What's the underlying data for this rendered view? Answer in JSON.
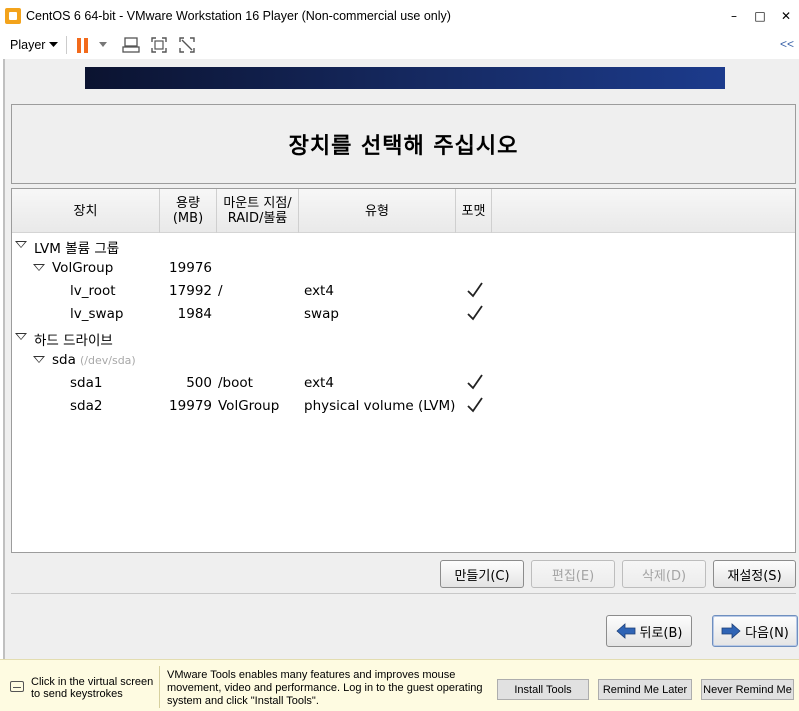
{
  "window": {
    "title": "CentOS 6 64-bit - VMware Workstation 16 Player (Non-commercial use only)",
    "minimize": "–",
    "maximize": "□",
    "close": "✕"
  },
  "toolbar": {
    "player_menu": "Player",
    "collapse": "<<"
  },
  "installer": {
    "heading": "장치를 선택해 주십시오",
    "columns": {
      "device": "장치",
      "size_line1": "용량",
      "size_line2": "(MB)",
      "mount_line1": "마운트 지점/",
      "mount_line2": "RAID/볼륨",
      "type": "유형",
      "format": "포맷"
    },
    "rows": [
      {
        "device": "LVM 볼륨 그룹",
        "size": "",
        "mount": "",
        "type": "",
        "format": false,
        "level": 0,
        "expander": true
      },
      {
        "device": "VolGroup",
        "size": "19976",
        "mount": "",
        "type": "",
        "format": false,
        "level": 1,
        "expander": true
      },
      {
        "device": "lv_root",
        "size": "17992",
        "mount": "/",
        "type": "ext4",
        "format": true,
        "level": 2,
        "expander": false
      },
      {
        "device": "lv_swap",
        "size": "1984",
        "mount": "",
        "type": "swap",
        "format": true,
        "level": 2,
        "expander": false
      },
      {
        "device": "하드 드라이브",
        "size": "",
        "mount": "",
        "type": "",
        "format": false,
        "level": 0,
        "expander": true
      },
      {
        "device": "sda",
        "device_path": "(/dev/sda)",
        "size": "",
        "mount": "",
        "type": "",
        "format": false,
        "level": 1,
        "expander": true
      },
      {
        "device": "sda1",
        "size": "500",
        "mount": "/boot",
        "type": "ext4",
        "format": true,
        "level": 2,
        "expander": false
      },
      {
        "device": "sda2",
        "size": "19979",
        "mount": "VolGroup",
        "type": "physical volume (LVM)",
        "format": true,
        "level": 2,
        "expander": false
      }
    ],
    "check_mark": "✓",
    "buttons": {
      "create": "만들기(C)",
      "edit": "편집(E)",
      "delete": "삭제(D)",
      "reset": "재설정(S)",
      "back": "뒤로(B)",
      "next": "다음(N)"
    }
  },
  "tools_bar": {
    "hint": "Click in the virtual screen to send keystrokes",
    "message": "VMware Tools enables many features and improves mouse movement, video and performance. Log in to the guest operating system and click \"Install Tools\".",
    "install": "Install Tools",
    "remind_later": "Remind Me Later",
    "never_remind": "Never Remind Me"
  },
  "colors": {
    "pause": "#f26a1b",
    "arrow": "#2f64b5",
    "banner": "#162a63"
  }
}
